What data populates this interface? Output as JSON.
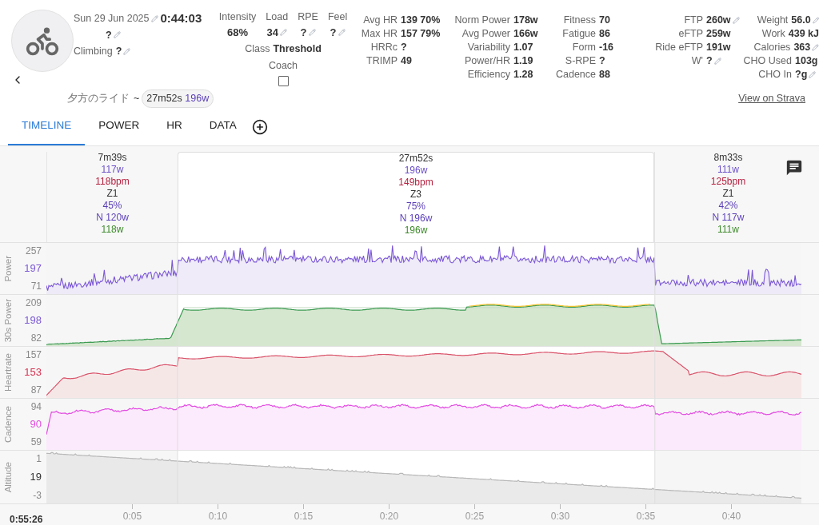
{
  "activity": {
    "date": "Sun 29 Jun 2025",
    "duration": "0:44:03",
    "date_value": "?",
    "climbing_label": "Climbing",
    "climbing_value": "?",
    "name": "夕方のライド",
    "separator": "~",
    "chip_time": "27m52s",
    "chip_power": "196w",
    "link": "View on Strava"
  },
  "summary": [
    {
      "label": "Intensity",
      "value": "68%",
      "editable": false
    },
    {
      "label": "Load",
      "value": "34",
      "editable": true
    },
    {
      "label": "RPE",
      "value": "?",
      "editable": true
    },
    {
      "label": "Feel",
      "value": "?",
      "editable": true
    }
  ],
  "class": {
    "label": "Class",
    "value": "Threshold"
  },
  "coach": {
    "label": "Coach",
    "checked": false
  },
  "stat_columns": [
    [
      {
        "label": "Avg HR",
        "value": "139 70%",
        "editable": false
      },
      {
        "label": "Max HR",
        "value": "157 79%",
        "editable": false
      },
      {
        "label": "HRRc",
        "value": "?",
        "editable": false
      },
      {
        "label": "TRIMP",
        "value": "49",
        "editable": false
      }
    ],
    [
      {
        "label": "Norm Power",
        "value": "178w",
        "editable": false
      },
      {
        "label": "Avg Power",
        "value": "166w",
        "editable": false
      },
      {
        "label": "Variability",
        "value": "1.07",
        "editable": false
      },
      {
        "label": "Power/HR",
        "value": "1.19",
        "editable": false
      },
      {
        "label": "Efficiency",
        "value": "1.28",
        "editable": false
      }
    ],
    [
      {
        "label": "Fitness",
        "value": "70",
        "editable": false
      },
      {
        "label": "Fatigue",
        "value": "86",
        "editable": false
      },
      {
        "label": "Form",
        "value": "-16",
        "editable": false
      },
      {
        "label": "S-RPE",
        "value": "?",
        "editable": false
      },
      {
        "label": "Cadence",
        "value": "88",
        "editable": false
      }
    ],
    [
      {
        "label": "FTP",
        "value": "260w",
        "editable": true
      },
      {
        "label": "eFTP",
        "value": "259w",
        "editable": false
      },
      {
        "label": "Ride eFTP",
        "value": "191w",
        "editable": false
      },
      {
        "label": "W'",
        "value": "?",
        "editable": true
      }
    ],
    [
      {
        "label": "Weight",
        "value": "56.0",
        "editable": true
      },
      {
        "label": "Work",
        "value": "439 kJ",
        "editable": false
      },
      {
        "label": "Calories",
        "value": "363",
        "editable": true
      },
      {
        "label": "CHO Used",
        "value": "103g",
        "editable": false
      },
      {
        "label": "CHO In",
        "value": "?g",
        "editable": true
      }
    ]
  ],
  "tabs": [
    {
      "label": "TIMELINE",
      "selected": true
    },
    {
      "label": "POWER",
      "selected": false
    },
    {
      "label": "HR",
      "selected": false
    },
    {
      "label": "DATA",
      "selected": false
    }
  ],
  "intervals": [
    {
      "selected": false,
      "lines": [
        {
          "kind": "duration",
          "text": "7m39s"
        },
        {
          "kind": "power",
          "text": "117w"
        },
        {
          "kind": "hr",
          "text": "118bpm"
        },
        {
          "kind": "zone",
          "text": "Z1"
        },
        {
          "kind": "percent",
          "text": "45%"
        },
        {
          "kind": "norm",
          "text": "N 120w"
        },
        {
          "kind": "avg",
          "text": "118w"
        }
      ]
    },
    {
      "selected": true,
      "lines": [
        {
          "kind": "duration",
          "text": "27m52s"
        },
        {
          "kind": "power",
          "text": "196w"
        },
        {
          "kind": "hr",
          "text": "149bpm"
        },
        {
          "kind": "zone",
          "text": "Z3"
        },
        {
          "kind": "percent",
          "text": "75%"
        },
        {
          "kind": "norm",
          "text": "N 196w"
        },
        {
          "kind": "avg",
          "text": "196w"
        }
      ]
    },
    {
      "selected": false,
      "lines": [
        {
          "kind": "duration",
          "text": "8m33s"
        },
        {
          "kind": "power",
          "text": "111w"
        },
        {
          "kind": "hr",
          "text": "125bpm"
        },
        {
          "kind": "zone",
          "text": "Z1"
        },
        {
          "kind": "percent",
          "text": "42%"
        },
        {
          "kind": "norm",
          "text": "N 117w"
        },
        {
          "kind": "avg",
          "text": "111w"
        }
      ]
    }
  ],
  "panels": [
    {
      "kind": "power",
      "title": "Power",
      "ticks": [
        "257",
        "197",
        "71"
      ],
      "color": "#7b57d6"
    },
    {
      "kind": "smooth",
      "title": "30s Power",
      "ticks": [
        "209",
        "198",
        "82"
      ],
      "color": "#7b57d6"
    },
    {
      "kind": "hr",
      "title": "Heartrate",
      "ticks": [
        "157",
        "153",
        "87"
      ],
      "color": "#d9304f"
    },
    {
      "kind": "cadence",
      "title": "Cadence",
      "ticks": [
        "94",
        "90",
        "59"
      ],
      "color": "#e24de2"
    },
    {
      "kind": "altitude",
      "title": "Altitude",
      "ticks": [
        "1",
        "19",
        "-3"
      ],
      "color": "#333333"
    }
  ],
  "x_axis": {
    "start": "0:55:26",
    "ticks": [
      "0:05",
      "0:10",
      "0:15",
      "0:20",
      "0:25",
      "0:30",
      "0:35",
      "0:40"
    ]
  }
}
